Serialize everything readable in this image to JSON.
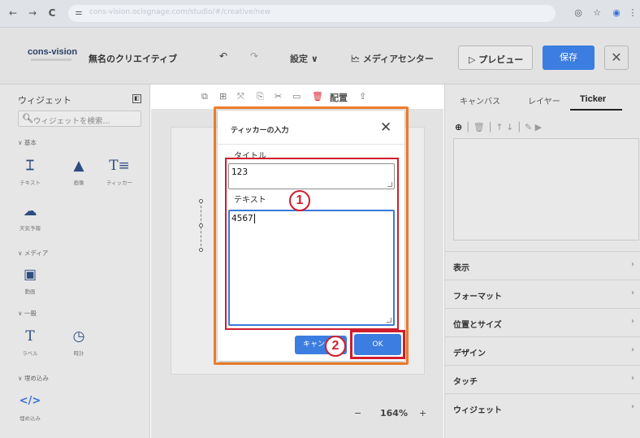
{
  "browser": {
    "url": "cons-vision.ocisgnage.com/studio/#/creative/new",
    "back_icon": "←",
    "forward_icon": "→",
    "reload_icon": "C",
    "eye_icon": "◎",
    "star_icon": "☆",
    "profile_icon": "◉",
    "menu_icon": "⋮"
  },
  "header": {
    "logo": "cons-vision",
    "title": "無名のクリエイティブ",
    "undo": "↶",
    "redo": "↷",
    "settings": "設定 ∨",
    "media_center": "メディアセンター",
    "preview": "▷ プレビュー",
    "save": "保存",
    "close": "✕"
  },
  "left_panel": {
    "title": "ウィジェット",
    "search_placeholder": "ウィジェットを検索...",
    "sections": {
      "basic": "∨ 基本",
      "media": "∨ メディア",
      "general": "∨ 一般",
      "embed": "∨ 埋め込み"
    },
    "widgets": {
      "text": "テキスト",
      "image": "画像",
      "ticker": "ティッカー",
      "weather": "天気予報",
      "video": "動画",
      "label": "ラベル",
      "clock": "時計",
      "embed": "埋め込み"
    }
  },
  "toolbar": {
    "arrange": "配置"
  },
  "canvas": {
    "zoom_minus": "−",
    "zoom_level": "164%",
    "zoom_plus": "+"
  },
  "right_panel": {
    "tabs": [
      "キャンバス",
      "レイヤー",
      "Ticker"
    ],
    "tools_add": "⊕",
    "tools_rest": "│ 🗑 │ ↑ ↓ │ ✎ ▶",
    "accordions": [
      "表示",
      "フォーマット",
      "位置とサイズ",
      "デザイン",
      "タッチ",
      "ウィジェット"
    ]
  },
  "dialog": {
    "title": "ティッカーの入力",
    "close": "✕",
    "title_label": "タイトル",
    "title_value": "123",
    "text_label": "テキスト",
    "text_value": "4567",
    "cancel": "キャンセル",
    "ok": "OK"
  },
  "annotations": {
    "step1": "1",
    "step2": "2"
  },
  "colors": {
    "accent_blue": "#3b7de0",
    "annotation_red": "#cf1d2e",
    "annotation_orange": "#ee7d2b"
  }
}
